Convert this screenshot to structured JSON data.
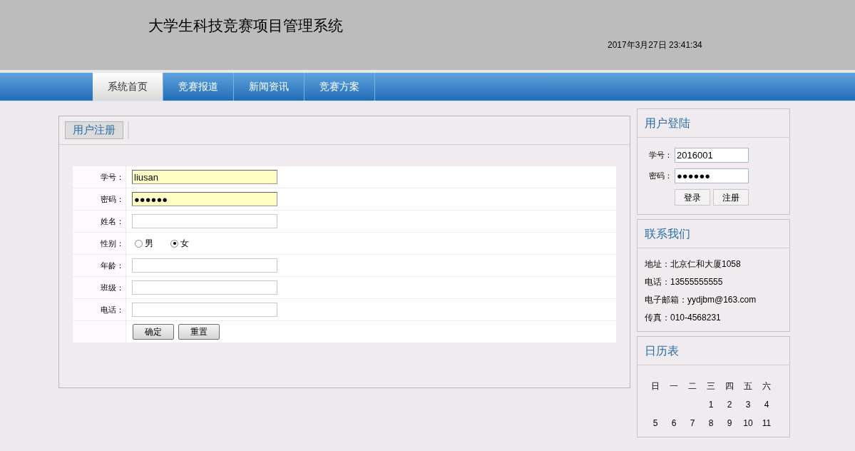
{
  "header": {
    "title": "大学生科技竞赛项目管理系统",
    "datetime": "2017年3月27日 23:41:34"
  },
  "nav": [
    {
      "label": "系统首页",
      "selected": true
    },
    {
      "label": "竞赛报道",
      "selected": false
    },
    {
      "label": "新闻资讯",
      "selected": false
    },
    {
      "label": "竞赛方案",
      "selected": false
    }
  ],
  "register": {
    "tab": "用户注册",
    "fields": [
      {
        "kind": "input",
        "label": "学号：",
        "value": "liusan",
        "highlighted": true
      },
      {
        "kind": "input",
        "label": "密码：",
        "value": "●●●●●●",
        "highlighted": true
      },
      {
        "kind": "input",
        "label": "姓名：",
        "highlighted": false
      },
      {
        "kind": "radio",
        "label": "性别：",
        "options": [
          {
            "label": "男",
            "selected": false
          },
          {
            "label": "女",
            "selected": true
          }
        ]
      },
      {
        "kind": "input",
        "label": "年龄：",
        "highlighted": false
      },
      {
        "kind": "input",
        "label": "班级：",
        "highlighted": false
      },
      {
        "kind": "input",
        "label": "电话：",
        "highlighted": false
      }
    ],
    "buttons": [
      "确定",
      "重置"
    ]
  },
  "login": {
    "title": "用户登陆",
    "fields": [
      {
        "label": "学号：",
        "value": "2016001"
      },
      {
        "label": "密码：",
        "value": "●●●●●●"
      }
    ],
    "buttons": [
      "登录",
      "注册"
    ]
  },
  "contact": {
    "title": "联系我们",
    "lines": [
      "地址：北京仁和大厦1058",
      "电话：13555555555",
      "电子邮箱：yydjbm@163.com",
      "传真：010-4568231"
    ]
  },
  "calendar": {
    "title": "日历表",
    "weekdays": [
      "日",
      "一",
      "二",
      "三",
      "四",
      "五",
      "六"
    ],
    "weeks": [
      {
        "kind": "partial",
        "days": [
          "1",
          "2",
          "3",
          "4"
        ]
      },
      {
        "kind": "full",
        "days": [
          "5",
          "6",
          "7",
          "8",
          "9",
          "10",
          "11"
        ]
      }
    ]
  }
}
